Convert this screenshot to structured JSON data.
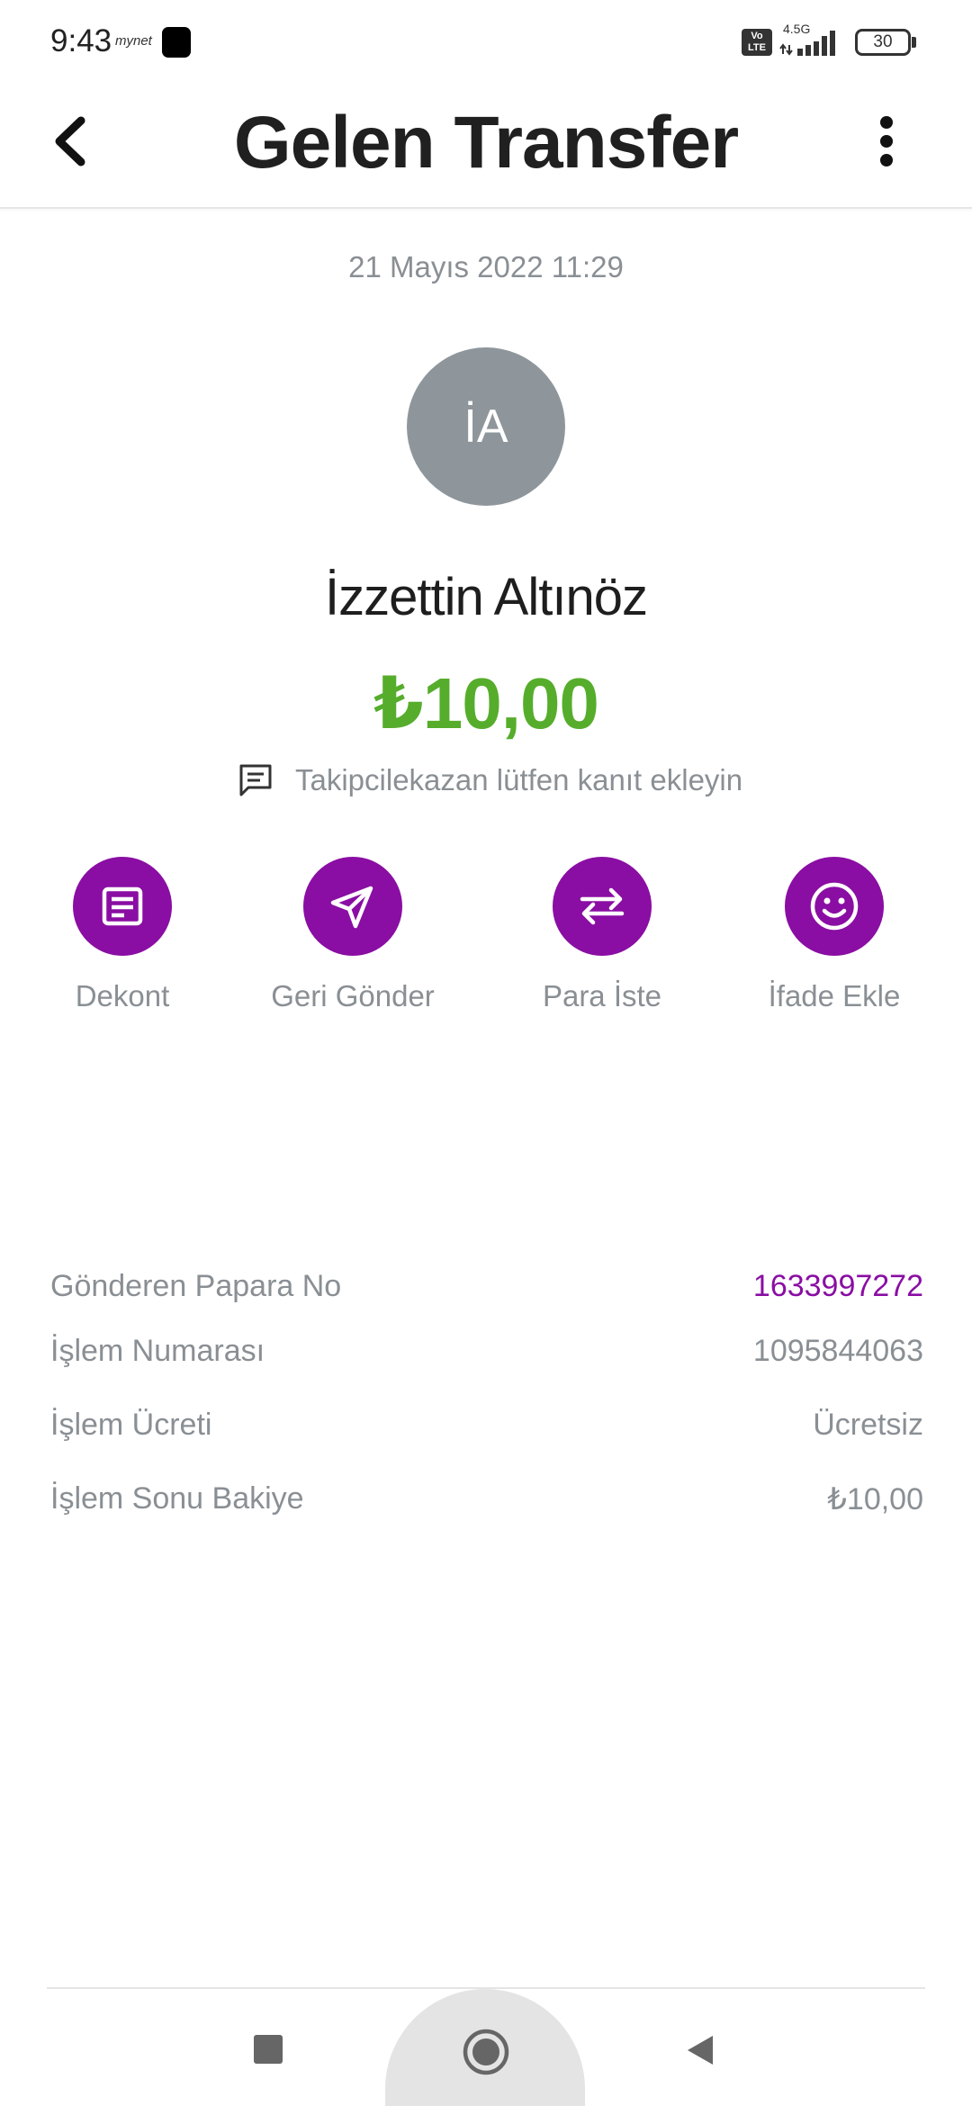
{
  "status_bar": {
    "time": "9:43",
    "brand": "mynet",
    "volte": "Vo LTE",
    "network": "4.5G",
    "battery": "30"
  },
  "header": {
    "title": "Gelen Transfer",
    "back_icon": "chevron-left-icon",
    "more_icon": "more-vertical-icon"
  },
  "transfer": {
    "date": "21 Mayıs 2022 11:29",
    "avatar_initials": "İA",
    "sender_name": "İzzettin Altınöz",
    "amount": "₺10,00",
    "note": "Takipcilekazan lütfen kanıt ekleyin"
  },
  "actions": [
    {
      "label": "Dekont",
      "icon": "receipt-icon"
    },
    {
      "label": "Geri Gönder",
      "icon": "send-icon"
    },
    {
      "label": "Para İste",
      "icon": "swap-icon"
    },
    {
      "label": "İfade Ekle",
      "icon": "smiley-icon"
    }
  ],
  "details": [
    {
      "label": "Gönderen Papara No",
      "value": "1633997272"
    },
    {
      "label": "İşlem Numarası",
      "value": "1095844063"
    },
    {
      "label": "İşlem Ücreti",
      "value": "Ücretsiz"
    },
    {
      "label": "İşlem Sonu Bakiye",
      "value": "₺10,00"
    }
  ],
  "colors": {
    "accent": "#8a0ea3",
    "amount": "#56ad2c",
    "muted_text": "#8a8f94",
    "avatar": "#8e969c"
  }
}
